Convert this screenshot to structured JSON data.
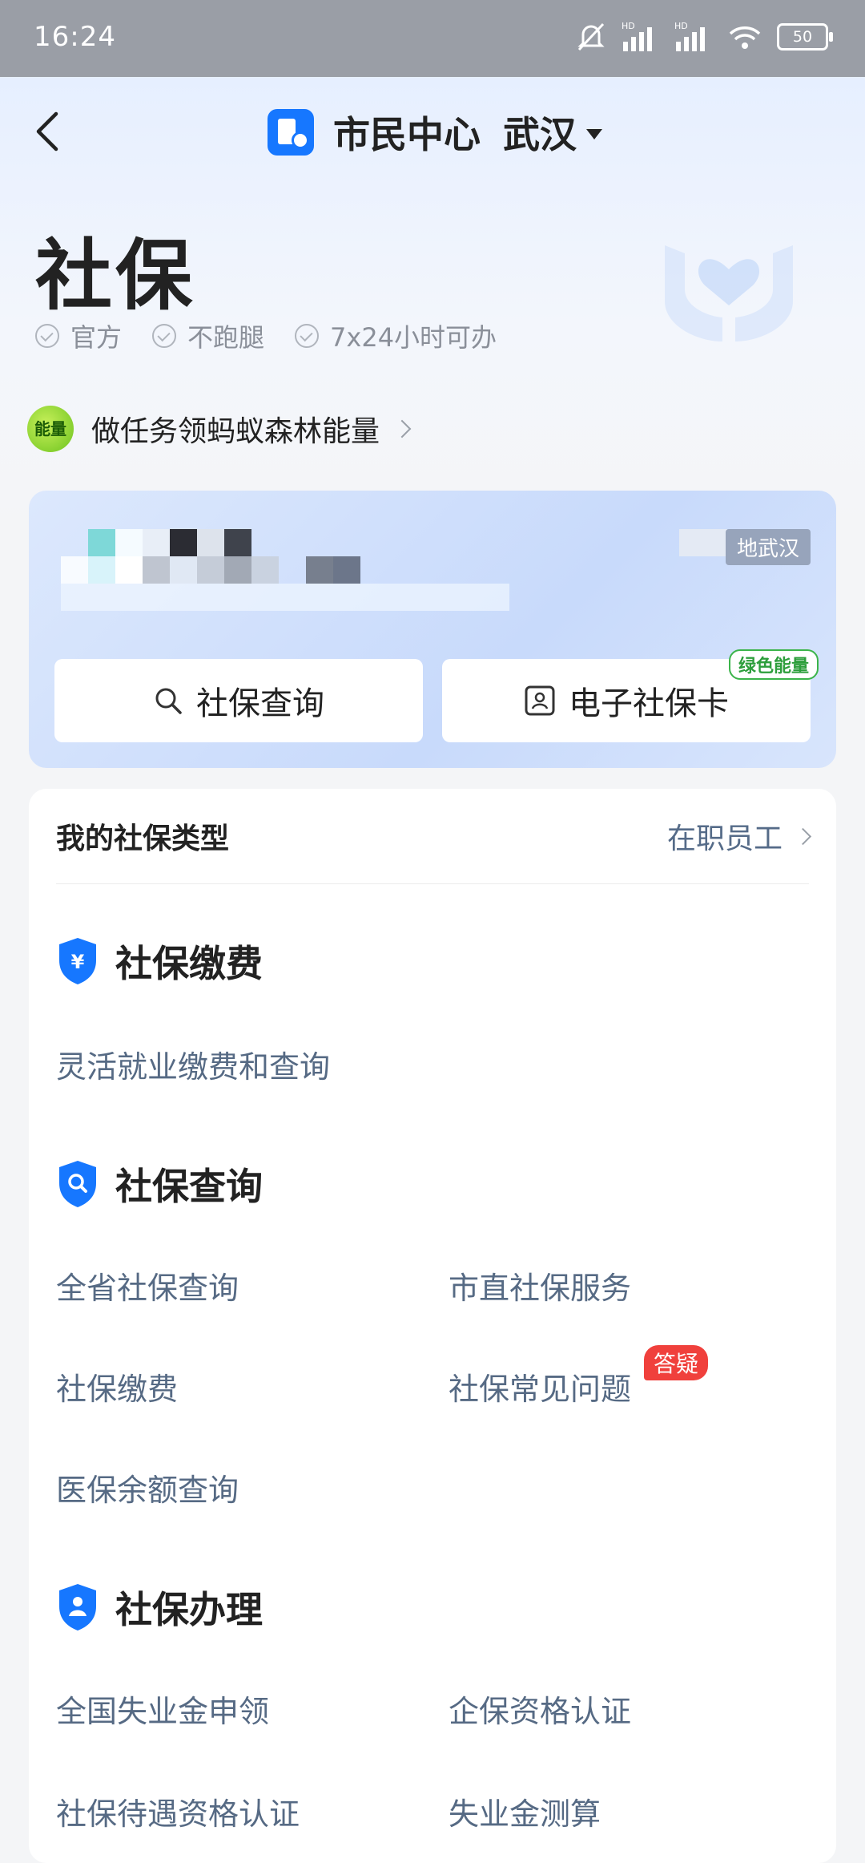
{
  "status_bar": {
    "time": "16:24",
    "battery": "50"
  },
  "nav": {
    "title": "市民中心",
    "city": "武汉"
  },
  "hero": {
    "title": "社保",
    "badges": [
      "官方",
      "不跑腿",
      "7x24小时可办"
    ],
    "energy_text": "做任务领蚂蚁森林能量",
    "energy_ball": "能量"
  },
  "card": {
    "city_tag": "地武汉",
    "btn_query": "社保查询",
    "btn_card": "电子社保卡",
    "green_tag": "绿色能量"
  },
  "services": {
    "type_label": "我的社保类型",
    "type_value": "在职员工",
    "section1": {
      "title": "社保缴费",
      "items": [
        "灵活就业缴费和查询"
      ]
    },
    "section2": {
      "title": "社保查询",
      "items": [
        "全省社保查询",
        "市直社保服务",
        "社保缴费",
        "社保常见问题",
        "医保余额查询"
      ],
      "hot_tag": "答疑"
    },
    "section3": {
      "title": "社保办理",
      "items": [
        "全国失业金申领",
        "企保资格认证",
        "社保待遇资格认证",
        "失业金测算"
      ]
    }
  },
  "colors": {
    "brand": "#1677ff",
    "hot": "#f0403c",
    "green": "#3bb44a"
  }
}
